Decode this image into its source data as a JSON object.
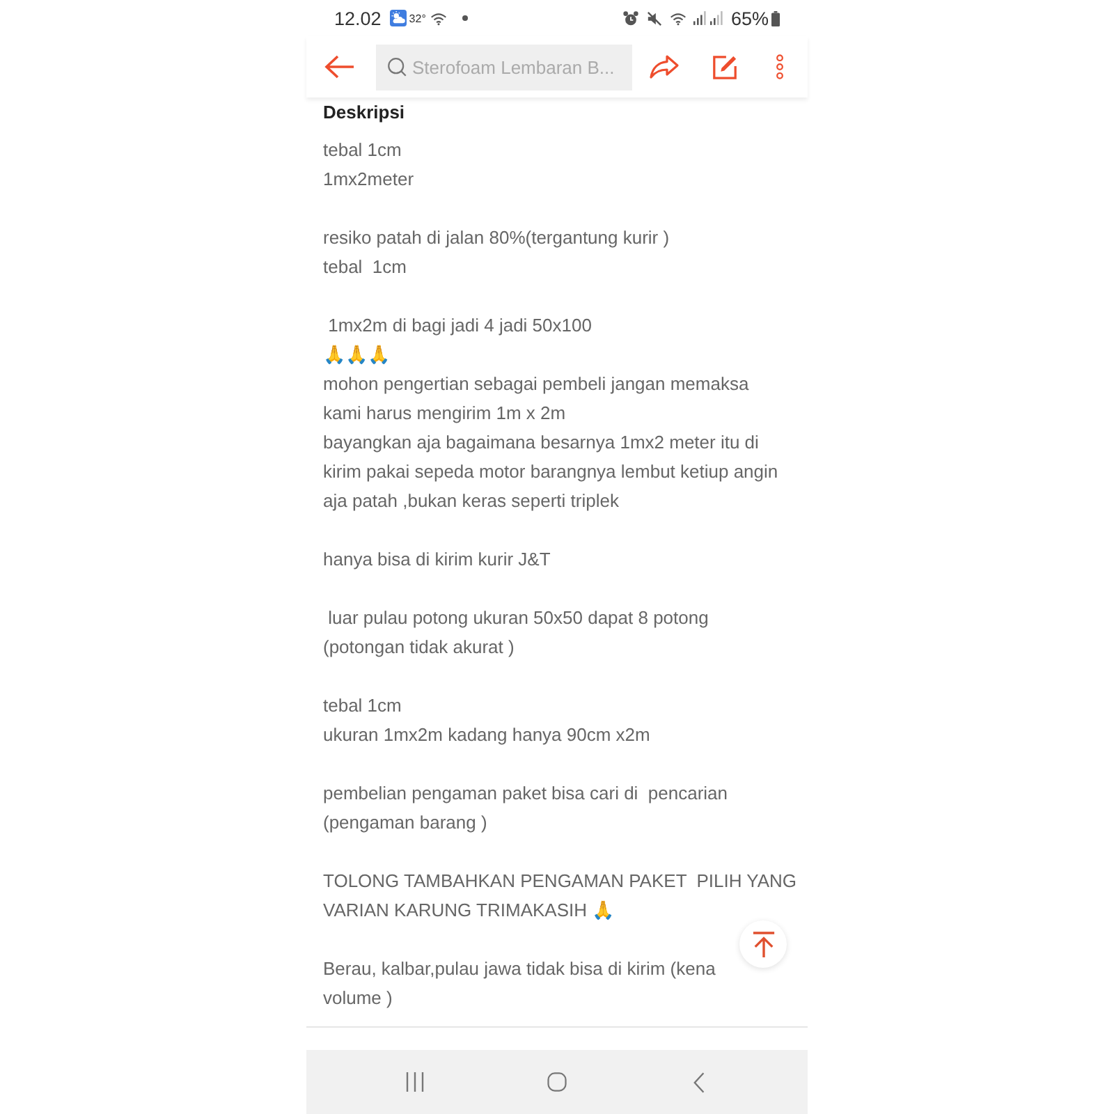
{
  "status_bar": {
    "time": "12.02",
    "temperature": "32°",
    "battery": "65%"
  },
  "toolbar": {
    "search": {
      "placeholder": "Sterofoam Lembaran B..."
    }
  },
  "description": {
    "heading": "Deskripsi",
    "paragraphs": [
      [
        "tebal 1cm",
        "1mx2meter"
      ],
      [
        "resiko patah di jalan 80%(tergantung kurir )",
        "tebal  1cm"
      ],
      [
        " 1mx2m di bagi jadi 4 jadi 50x100",
        "🙏🙏🙏",
        "mohon pengertian sebagai pembeli jangan memaksa",
        "kami harus mengirim 1m x 2m",
        "bayangkan aja bagaimana besarnya 1mx2 meter itu di",
        "kirim pakai sepeda motor barangnya lembut ketiup angin",
        "aja patah ,bukan keras seperti triplek"
      ],
      [
        "hanya bisa di kirim kurir J&T"
      ],
      [
        " luar pulau potong ukuran 50x50 dapat 8 potong",
        "(potongan tidak akurat )"
      ],
      [
        "tebal 1cm",
        "ukuran 1mx2m kadang hanya 90cm x2m"
      ],
      [
        "pembelian pengaman paket bisa cari di  pencarian",
        "(pengaman barang )"
      ],
      [
        "TOLONG TAMBAHKAN PENGAMAN PAKET  PILIH YANG",
        "VARIAN KARUNG TRIMAKASIH 🙏"
      ],
      [
        "Berau, kalbar,pulau jawa tidak bisa di kirim (kena",
        "volume )"
      ]
    ]
  }
}
